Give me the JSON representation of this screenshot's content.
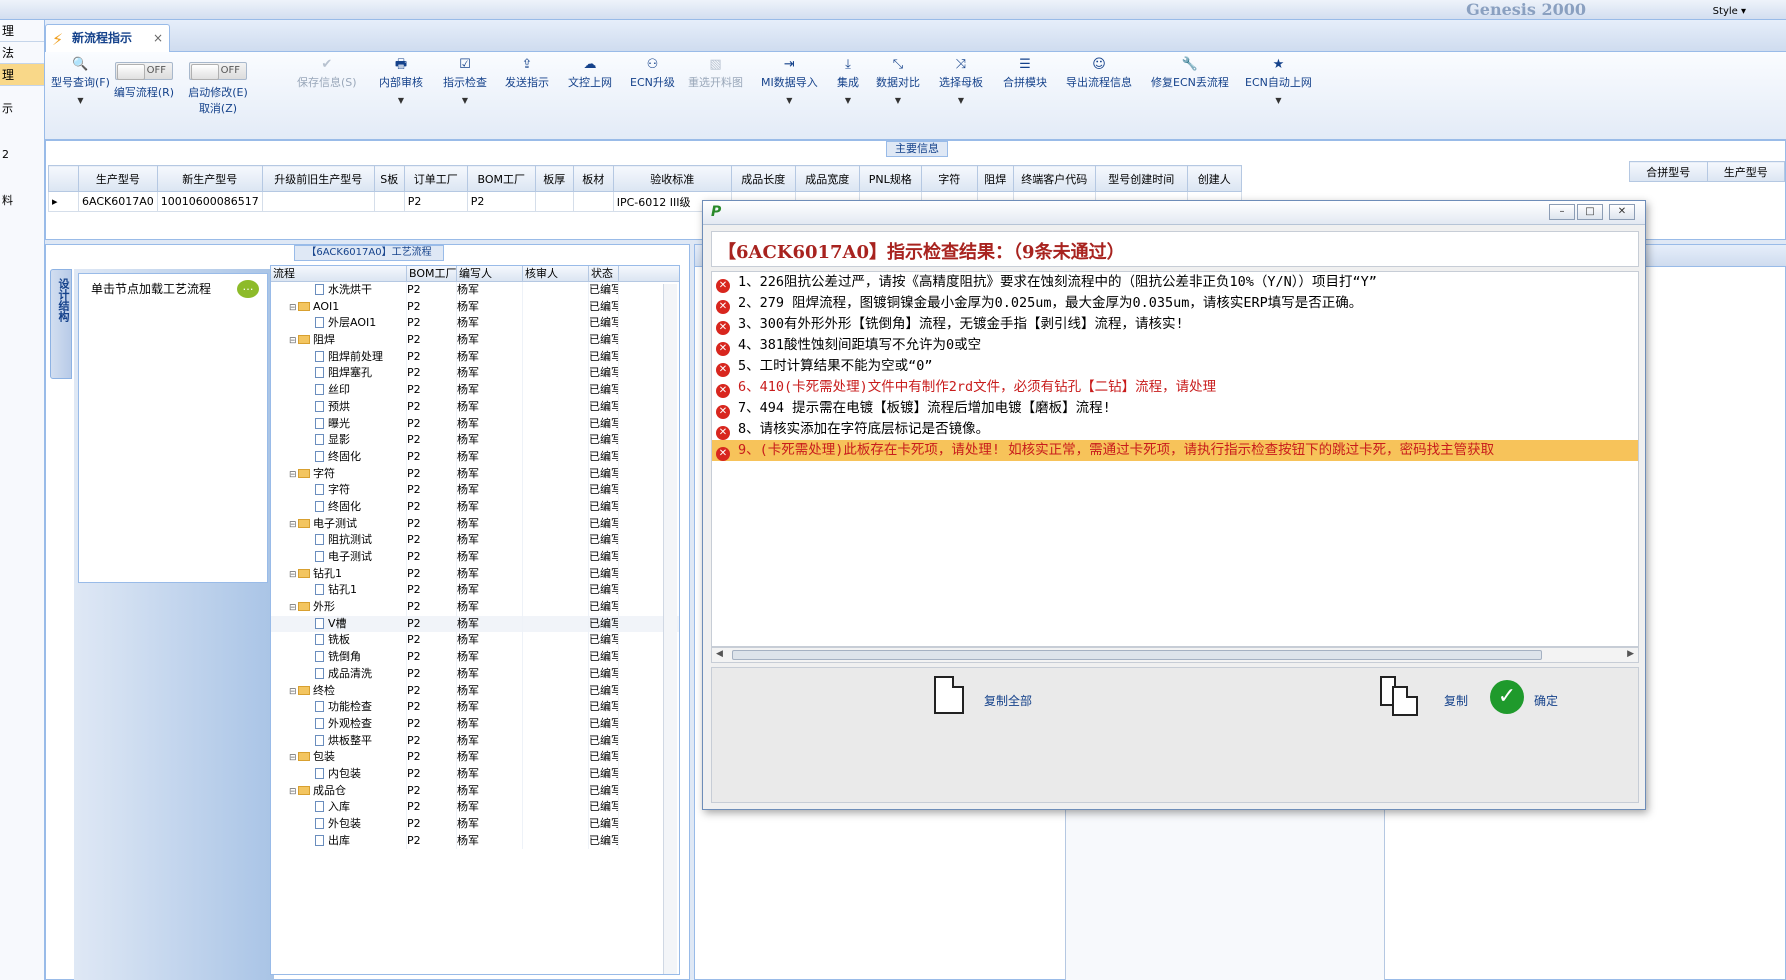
{
  "top": {
    "logo_text": "Genesis 2000",
    "style_label": "Style ▾"
  },
  "leftnav": {
    "items": [
      "理",
      "法",
      "理",
      "示",
      "2",
      "料"
    ]
  },
  "tab": {
    "title": "新流程指示",
    "close": "×"
  },
  "toolbar": {
    "model_query": "型号查询(F)",
    "edit_flow": "编写流程(R)",
    "enable_modify": "启动修改(E)",
    "cancel": "取消(Z)",
    "off_label": "OFF",
    "save_info": "保存信息(S)",
    "internal_review": "内部审核",
    "instruction_check": "指示检查",
    "send_instruction": "发送指示",
    "doc_upload": "文控上网",
    "ecn_upgrade": "ECN升级",
    "reselect_cut": "重选开料图",
    "mi_import": "MI数据导入",
    "integrate": "集成",
    "data_compare": "数据对比",
    "select_parent": "选择母板",
    "merge_module": "合拼模块",
    "export_flow": "导出流程信息",
    "fix_ecn": "修复ECN丢流程",
    "ecn_auto_upload": "ECN自动上网"
  },
  "main_info": {
    "title": "主要信息",
    "headers": [
      "生产型号",
      "新生产型号",
      "升级前旧生产型号",
      "S板",
      "订单工厂",
      "BOM工厂",
      "板厚",
      "板材",
      "验收标准",
      "成品长度",
      "成品宽度",
      "PNL规格",
      "字符",
      "阻焊",
      "终端客户代码",
      "型号创建时间",
      "创建人"
    ],
    "row": [
      "6ACK6017A0",
      "10010600086517",
      "",
      "",
      "P2",
      "P2",
      "",
      "",
      "IPC-6012 III级",
      "",
      "",
      "",
      "",
      "",
      "",
      "",
      ""
    ],
    "right_headers": [
      "合拼型号",
      "生产型号"
    ]
  },
  "process": {
    "title": "【6ACK6017A0】工艺流程",
    "side_tab": "设计结构",
    "hint": "单击节点加载工艺流程",
    "columns": [
      "流程",
      "BOM工厂",
      "编写人",
      "核审人",
      "状态"
    ],
    "rows": [
      {
        "name": "水洗烘干",
        "level": 2,
        "folder": false,
        "bom": "P2",
        "writer": "杨军",
        "status": "已编写"
      },
      {
        "name": "AOI1",
        "level": 1,
        "folder": true,
        "bom": "P2",
        "writer": "杨军",
        "status": "已编写"
      },
      {
        "name": "外层AOI1",
        "level": 2,
        "folder": false,
        "bom": "P2",
        "writer": "杨军",
        "status": "已编写"
      },
      {
        "name": "阻焊",
        "level": 1,
        "folder": true,
        "bom": "P2",
        "writer": "杨军",
        "status": "已编写"
      },
      {
        "name": "阻焊前处理",
        "level": 2,
        "folder": false,
        "bom": "P2",
        "writer": "杨军",
        "status": "已编写"
      },
      {
        "name": "阻焊塞孔",
        "level": 2,
        "folder": false,
        "bom": "P2",
        "writer": "杨军",
        "status": "已编写"
      },
      {
        "name": "丝印",
        "level": 2,
        "folder": false,
        "bom": "P2",
        "writer": "杨军",
        "status": "已编写"
      },
      {
        "name": "预烘",
        "level": 2,
        "folder": false,
        "bom": "P2",
        "writer": "杨军",
        "status": "已编写"
      },
      {
        "name": "曝光",
        "level": 2,
        "folder": false,
        "bom": "P2",
        "writer": "杨军",
        "status": "已编写"
      },
      {
        "name": "显影",
        "level": 2,
        "folder": false,
        "bom": "P2",
        "writer": "杨军",
        "status": "已编写"
      },
      {
        "name": "终固化",
        "level": 2,
        "folder": false,
        "bom": "P2",
        "writer": "杨军",
        "status": "已编写"
      },
      {
        "name": "字符",
        "level": 1,
        "folder": true,
        "bom": "P2",
        "writer": "杨军",
        "status": "已编写"
      },
      {
        "name": "字符",
        "level": 2,
        "folder": false,
        "bom": "P2",
        "writer": "杨军",
        "status": "已编写"
      },
      {
        "name": "终固化",
        "level": 2,
        "folder": false,
        "bom": "P2",
        "writer": "杨军",
        "status": "已编写"
      },
      {
        "name": "电子测试",
        "level": 1,
        "folder": true,
        "bom": "P2",
        "writer": "杨军",
        "status": "已编写"
      },
      {
        "name": "阻抗测试",
        "level": 2,
        "folder": false,
        "bom": "P2",
        "writer": "杨军",
        "status": "已编写"
      },
      {
        "name": "电子测试",
        "level": 2,
        "folder": false,
        "bom": "P2",
        "writer": "杨军",
        "status": "已编写"
      },
      {
        "name": "钻孔1",
        "level": 1,
        "folder": true,
        "bom": "P2",
        "writer": "杨军",
        "status": "已编写"
      },
      {
        "name": "钻孔1",
        "level": 2,
        "folder": false,
        "bom": "P2",
        "writer": "杨军",
        "status": "已编写"
      },
      {
        "name": "外形",
        "level": 1,
        "folder": true,
        "bom": "P2",
        "writer": "杨军",
        "status": "已编写"
      },
      {
        "name": "V槽",
        "level": 2,
        "folder": false,
        "bom": "P2",
        "writer": "杨军",
        "status": "已编写",
        "selected": true
      },
      {
        "name": "铣板",
        "level": 2,
        "folder": false,
        "bom": "P2",
        "writer": "杨军",
        "status": "已编写"
      },
      {
        "name": "铣倒角",
        "level": 2,
        "folder": false,
        "bom": "P2",
        "writer": "杨军",
        "status": "已编写"
      },
      {
        "name": "成品清洗",
        "level": 2,
        "folder": false,
        "bom": "P2",
        "writer": "杨军",
        "status": "已编写"
      },
      {
        "name": "终检",
        "level": 1,
        "folder": true,
        "bom": "P2",
        "writer": "杨军",
        "status": "已编写"
      },
      {
        "name": "功能检查",
        "level": 2,
        "folder": false,
        "bom": "P2",
        "writer": "杨军",
        "status": "已编写"
      },
      {
        "name": "外观检查",
        "level": 2,
        "folder": false,
        "bom": "P2",
        "writer": "杨军",
        "status": "已编写"
      },
      {
        "name": "烘板整平",
        "level": 2,
        "folder": false,
        "bom": "P2",
        "writer": "杨军",
        "status": "已编写"
      },
      {
        "name": "包装",
        "level": 1,
        "folder": true,
        "bom": "P2",
        "writer": "杨军",
        "status": "已编写"
      },
      {
        "name": "内包装",
        "level": 2,
        "folder": false,
        "bom": "P2",
        "writer": "杨军",
        "status": "已编写"
      },
      {
        "name": "成品仓",
        "level": 1,
        "folder": true,
        "bom": "P2",
        "writer": "杨军",
        "status": "已编写"
      },
      {
        "name": "入库",
        "level": 2,
        "folder": false,
        "bom": "P2",
        "writer": "杨军",
        "status": "已编写"
      },
      {
        "name": "外包装",
        "level": 2,
        "folder": false,
        "bom": "P2",
        "writer": "杨军",
        "status": "已编写"
      },
      {
        "name": "出库",
        "level": 2,
        "folder": false,
        "bom": "P2",
        "writer": "杨军",
        "status": "已编写"
      }
    ]
  },
  "dialog": {
    "title": "【6ACK6017A0】指示检查结果：（9条未通过）",
    "items": [
      {
        "text": "1、226阻抗公差过严，请按《高精度阻抗》要求在蚀刻流程中的（阻抗公差非正负10%（Y/N））项目打“Y”",
        "style": "normal"
      },
      {
        "text": "2、279 阻焊流程，图镀铜镍金最小金厚为0.025um，最大金厚为0.035um，请核实ERP填写是否正确。",
        "style": "normal"
      },
      {
        "text": "3、300有外形外形【铣倒角】流程，无镀金手指【剥引线】流程，请核实!",
        "style": "normal"
      },
      {
        "text": "4、381酸性蚀刻间距填写不允许为0或空",
        "style": "normal"
      },
      {
        "text": "5、工时计算结果不能为空或“0”",
        "style": "normal"
      },
      {
        "text": "6、410(卡死需处理)文件中有制作2rd文件，必须有钻孔【二钻】流程，请处理",
        "style": "red"
      },
      {
        "text": "7、494 提示需在电镀【板镀】流程后增加电镀【磨板】流程!",
        "style": "normal"
      },
      {
        "text": "8、请核实添加在字符底层标记是否镜像。",
        "style": "normal"
      },
      {
        "text": "9、(卡死需处理)此板存在卡死项，请处理! 如核实正常，需通过卡死项，请执行指示检查按钮下的跳过卡死，密码找主管获取",
        "style": "highlight"
      }
    ],
    "copy_all": "复制全部",
    "copy": "复制",
    "ok": "确定"
  }
}
